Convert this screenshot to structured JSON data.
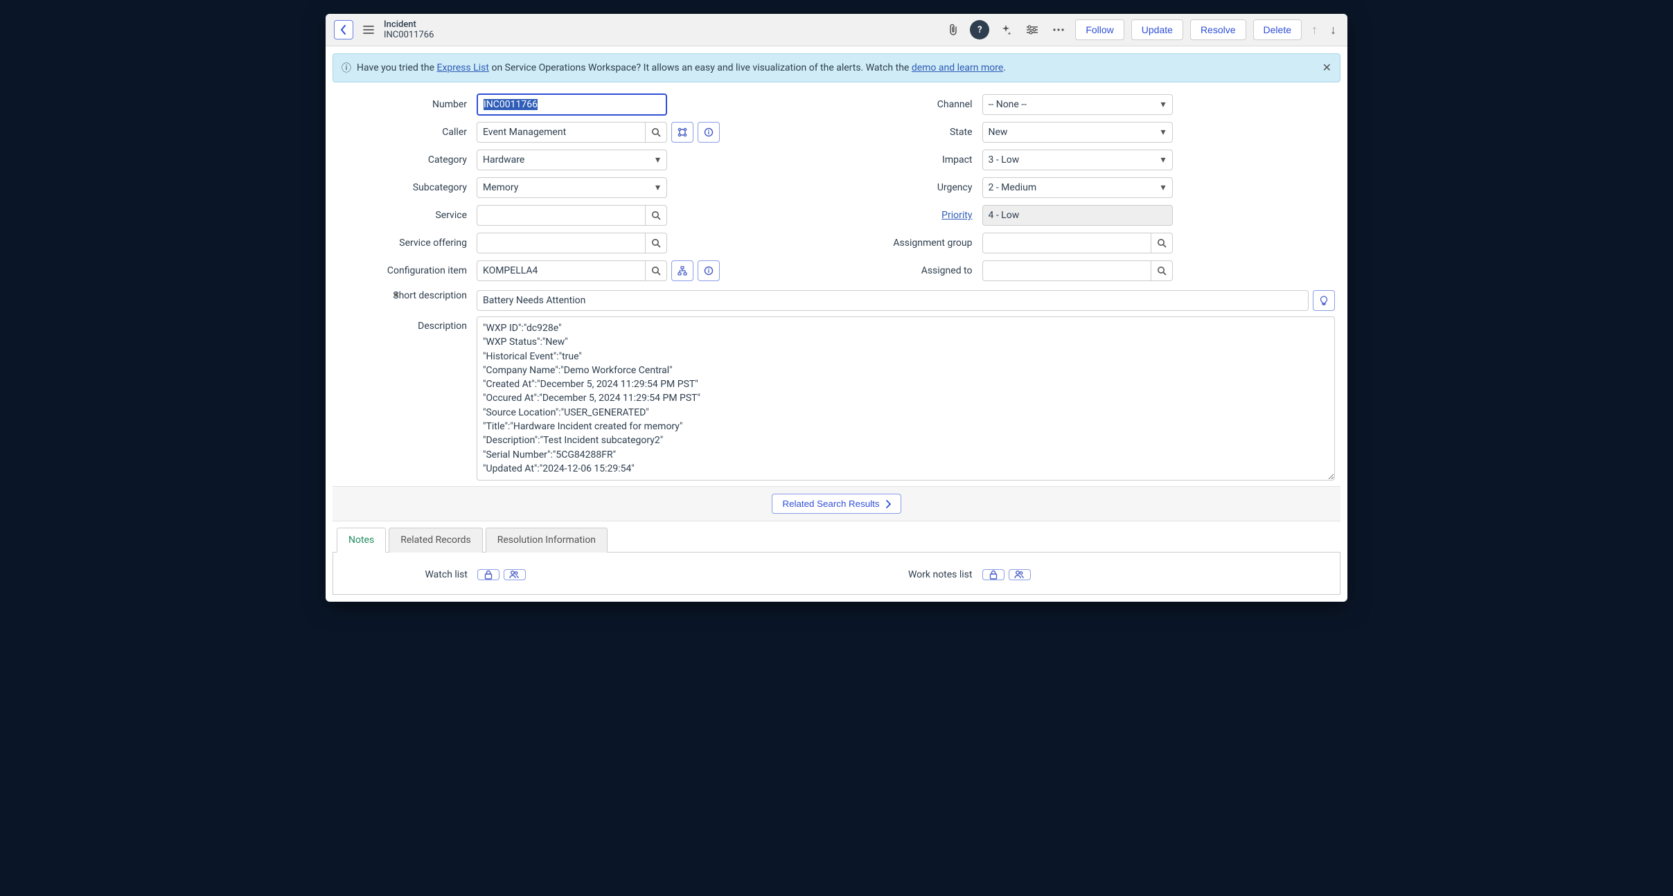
{
  "header": {
    "type": "Incident",
    "number": "INC0011766",
    "buttons": {
      "follow": "Follow",
      "update": "Update",
      "resolve": "Resolve",
      "delete": "Delete"
    }
  },
  "banner": {
    "pre": "Have you tried the ",
    "link1": "Express List",
    "mid": " on Service Operations Workspace? It allows an easy and live visualization of the alerts. Watch the ",
    "link2": "demo and learn more",
    "post": "."
  },
  "labels": {
    "number": "Number",
    "caller": "Caller",
    "category": "Category",
    "subcategory": "Subcategory",
    "service": "Service",
    "service_offering": "Service offering",
    "ci": "Configuration item",
    "channel": "Channel",
    "state": "State",
    "impact": "Impact",
    "urgency": "Urgency",
    "priority": "Priority",
    "assignment_group": "Assignment group",
    "assigned_to": "Assigned to",
    "short_description": "Short description",
    "description": "Description",
    "watch_list": "Watch list",
    "work_notes_list": "Work notes list"
  },
  "fields": {
    "number": "INC0011766",
    "caller": "Event Management",
    "category": "Hardware",
    "subcategory": "Memory",
    "service": "",
    "service_offering": "",
    "ci": "KOMPELLA4",
    "channel": "-- None --",
    "state": "New",
    "impact": "3 - Low",
    "urgency": "2 - Medium",
    "priority": "4 - Low",
    "assignment_group": "",
    "assigned_to": "",
    "short_description": "Battery Needs Attention",
    "description": "\"WXP ID\":\"dc928e\"\n\"WXP Status\":\"New\"\n\"Historical Event\":\"true\"\n\"Company Name\":\"Demo Workforce Central\"\n\"Created At\":\"December 5, 2024 11:29:54 PM PST\"\n\"Occured At\":\"December 5, 2024 11:29:54 PM PST\"\n\"Source Location\":\"USER_GENERATED\"\n\"Title\":\"Hardware Incident created for memory\"\n\"Description\":\"Test Incident subcategory2\"\n\"Serial Number\":\"5CG84288FR\"\n\"Updated At\":\"2024-12-06 15:29:54\""
  },
  "related": {
    "label": "Related Search Results"
  },
  "tabs": {
    "notes": "Notes",
    "related_records": "Related Records",
    "resolution": "Resolution Information"
  }
}
